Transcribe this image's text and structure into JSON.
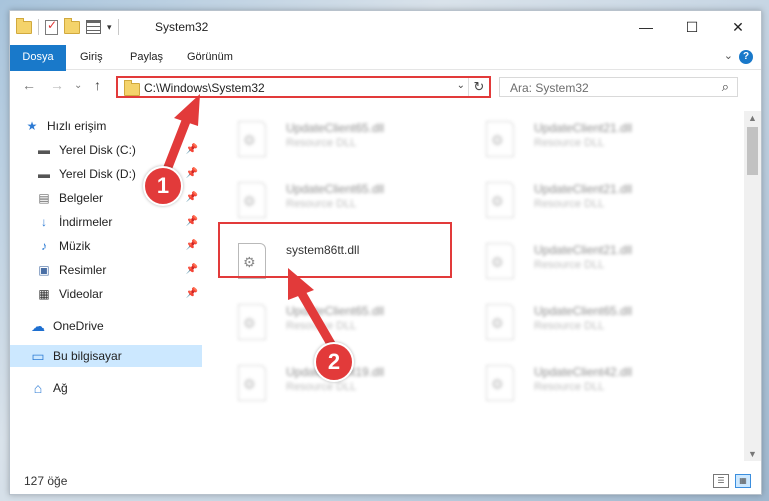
{
  "window": {
    "title": "System32",
    "qa_dropdown": "▾",
    "controls": {
      "minimize": "—",
      "maximize": "☐",
      "close": "✕"
    }
  },
  "ribbon": {
    "tabs": [
      {
        "label": "Dosya"
      },
      {
        "label": "Giriş"
      },
      {
        "label": "Paylaş"
      },
      {
        "label": "Görünüm"
      }
    ],
    "collapse": "⌄",
    "help": "?"
  },
  "nav": {
    "back": "←",
    "forward": "→",
    "recent": "⌄",
    "up": "↑",
    "address": "C:\\Windows\\System32",
    "address_dropdown": "⌄",
    "refresh": "↻",
    "search_placeholder": "Ara: System32",
    "search_icon": "⌕"
  },
  "sidebar": {
    "items": [
      {
        "label": "Hızlı erişim",
        "icon": "star-icon",
        "glyph": "★",
        "color": "#2d7bd4"
      },
      {
        "label": "Yerel Disk (C:)",
        "icon": "drive-c-icon",
        "glyph": "▬",
        "color": "#555555",
        "pinned": true
      },
      {
        "label": "Yerel Disk (D:)",
        "icon": "drive-d-icon",
        "glyph": "▬",
        "color": "#555555",
        "pinned": true
      },
      {
        "label": "Belgeler",
        "icon": "documents-icon",
        "glyph": "▤",
        "color": "#6b6b6b",
        "pinned": true
      },
      {
        "label": "İndirmeler",
        "icon": "downloads-icon",
        "glyph": "↓",
        "color": "#2d7bd4",
        "pinned": true
      },
      {
        "label": "Müzik",
        "icon": "music-icon",
        "glyph": "♪",
        "color": "#2d7bd4",
        "pinned": true
      },
      {
        "label": "Resimler",
        "icon": "pictures-icon",
        "glyph": "▣",
        "color": "#4a6fa5",
        "pinned": true
      },
      {
        "label": "Videolar",
        "icon": "videos-icon",
        "glyph": "▦",
        "color": "#333333",
        "pinned": true
      },
      {
        "label": "OneDrive",
        "icon": "onedrive-icon",
        "glyph": "☁",
        "color": "#1e6fd0"
      },
      {
        "label": "Bu bilgisayar",
        "icon": "this-pc-icon",
        "glyph": "▭",
        "color": "#2d7bd4",
        "selected": true
      },
      {
        "label": "Ağ",
        "icon": "network-icon",
        "glyph": "⌂",
        "color": "#2d7bd4"
      }
    ],
    "pin_glyph": "📌"
  },
  "files": {
    "focused": {
      "name": "system86tt.dll"
    },
    "blurred": [
      {
        "name": "UpdateClient65.dll",
        "type": "Resource DLL"
      },
      {
        "name": "UpdateClient21.dll",
        "type": "Resource DLL"
      },
      {
        "name": "UpdateClient65.dll",
        "type": "Resource DLL"
      },
      {
        "name": "UpdateClient21.dll",
        "type": "Resource DLL"
      },
      {
        "name": "UpdateClient21.dll",
        "type": "Resource DLL"
      },
      {
        "name": "UpdateClient65.dll",
        "type": "Resource DLL"
      },
      {
        "name": "UpdateClient65.dll",
        "type": "Resource DLL"
      },
      {
        "name": "UpdateClient19.dll",
        "type": "Resource DLL"
      },
      {
        "name": "UpdateClient42.dll",
        "type": "Resource DLL"
      }
    ]
  },
  "scroll": {
    "up": "▲",
    "down": "▼"
  },
  "status": {
    "count": "127 öğe",
    "details_view": "☰",
    "tiles_view": "▦"
  },
  "annotations": {
    "step1": "1",
    "step2": "2",
    "color": "#e23a3a"
  }
}
